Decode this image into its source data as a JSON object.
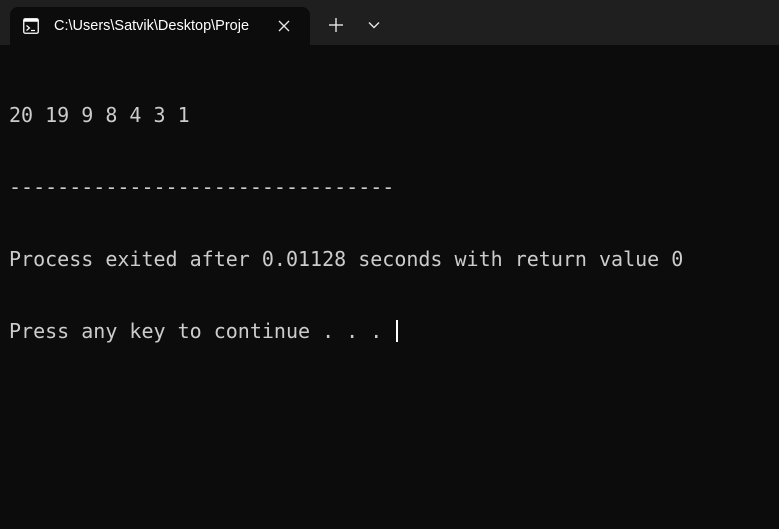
{
  "tab": {
    "title": "C:\\Users\\Satvik\\Desktop\\Proje",
    "icon": "console-icon",
    "close_icon": "close-icon"
  },
  "toolbar": {
    "new_tab_icon": "plus-icon",
    "dropdown_icon": "chevron-down-icon"
  },
  "terminal": {
    "lines": [
      "20 19 9 8 4 3 1",
      "--------------------------------",
      "Process exited after 0.01128 seconds with return value 0",
      "Press any key to continue . . . "
    ]
  },
  "colors": {
    "background": "#0c0c0c",
    "titlebar": "#1f1f1f",
    "text": "#cccccc"
  }
}
